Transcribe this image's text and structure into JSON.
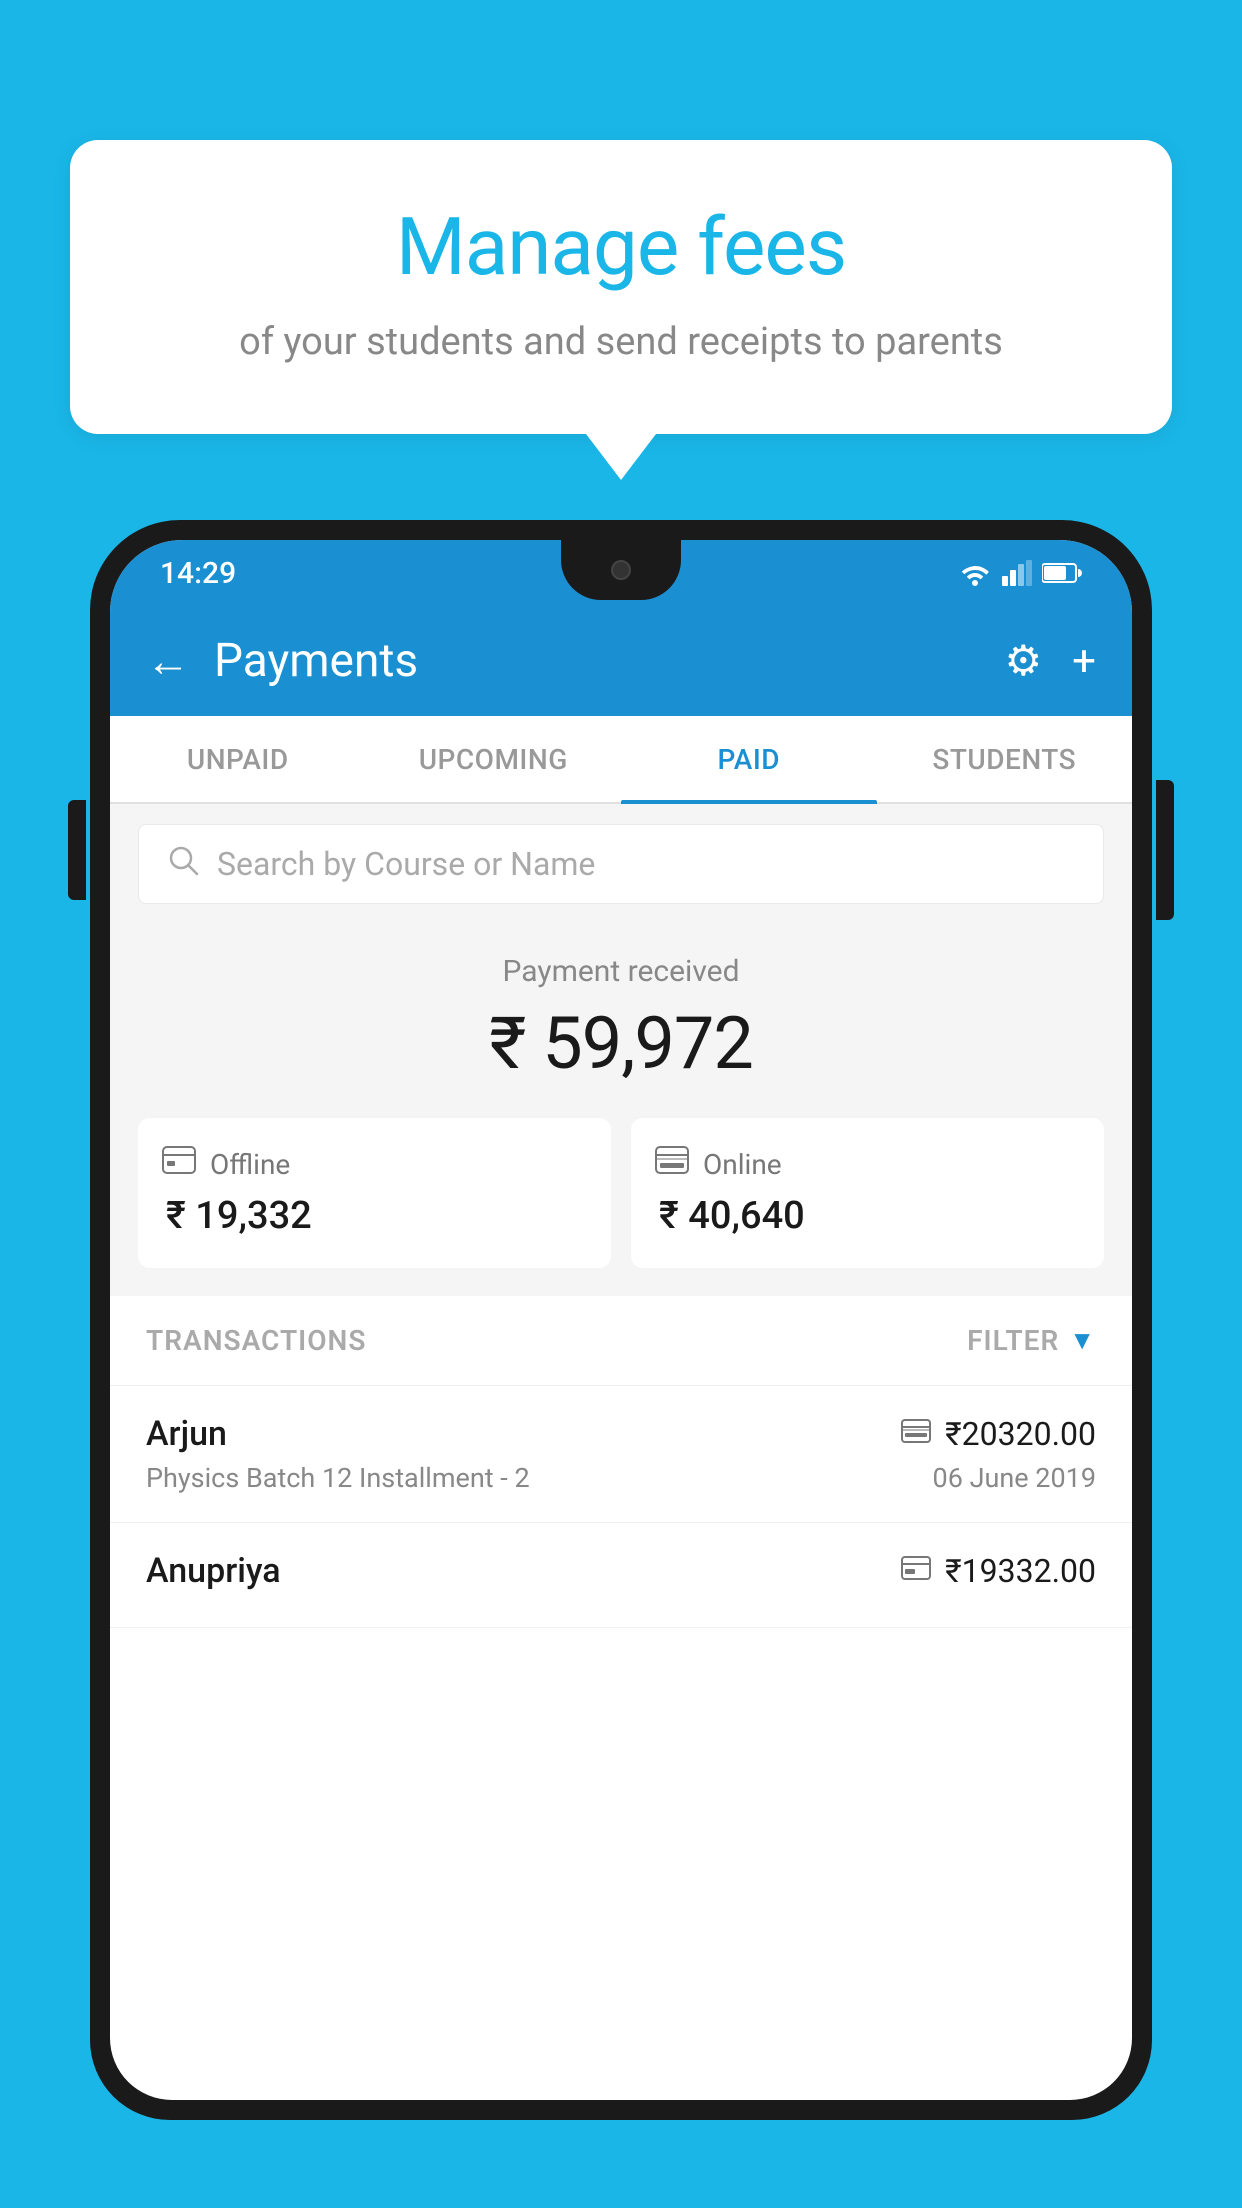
{
  "speech_bubble": {
    "title": "Manage fees",
    "subtitle": "of your students and send receipts to parents"
  },
  "status_bar": {
    "time": "14:29"
  },
  "app_bar": {
    "title": "Payments",
    "back_icon": "←",
    "gear_icon": "⚙",
    "plus_icon": "+"
  },
  "tabs": [
    {
      "label": "UNPAID",
      "active": false
    },
    {
      "label": "UPCOMING",
      "active": false
    },
    {
      "label": "PAID",
      "active": true
    },
    {
      "label": "STUDENTS",
      "active": false
    }
  ],
  "search": {
    "placeholder": "Search by Course or Name"
  },
  "payment_summary": {
    "label": "Payment received",
    "amount": "₹ 59,972"
  },
  "payment_cards": [
    {
      "icon": "offline",
      "label": "Offline",
      "amount": "₹ 19,332"
    },
    {
      "icon": "online",
      "label": "Online",
      "amount": "₹ 40,640"
    }
  ],
  "transactions_section": {
    "label": "TRANSACTIONS",
    "filter_label": "FILTER"
  },
  "transactions": [
    {
      "name": "Arjun",
      "course": "Physics Batch 12 Installment - 2",
      "amount": "₹20320.00",
      "date": "06 June 2019",
      "type": "online"
    },
    {
      "name": "Anupriya",
      "course": "",
      "amount": "₹19332.00",
      "date": "",
      "type": "offline"
    }
  ]
}
